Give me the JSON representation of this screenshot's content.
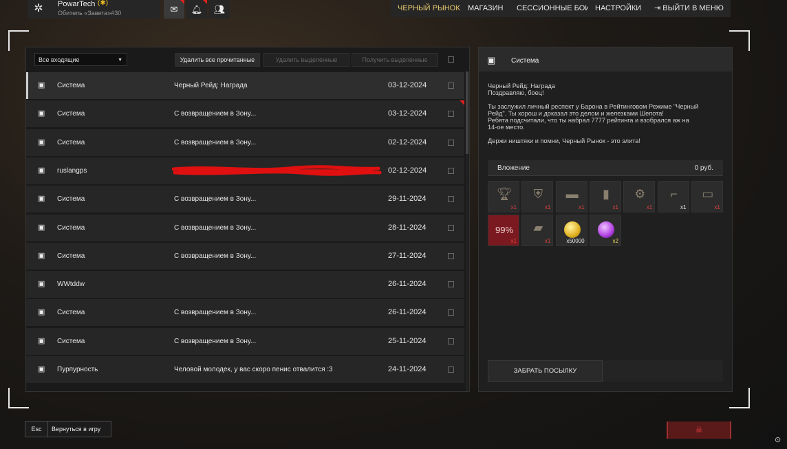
{
  "profile": {
    "username": "PowarTech",
    "rank_badge": "(✱)",
    "subtitle": "Обитель «Завета»#30"
  },
  "top_icons": [
    "mail-icon",
    "bell-icon",
    "friends-icon"
  ],
  "nav": {
    "black_market": "ЧЕРНЫЙ РЫНОК",
    "shop": "МАГАЗИН",
    "session_battles": "СЕССИОННЫЕ БОИ",
    "settings": "НАСТРОЙКИ",
    "exit_menu": "ВЫЙТИ В МЕНЮ",
    "active": "black_market"
  },
  "inbox": {
    "filter_selected": "Все входящие",
    "delete_read": "Удалить все прочитанные",
    "delete_selected": "Удалить выделенные",
    "get_selected": "Получить выделенные",
    "messages": [
      {
        "sender": "Система",
        "subject": "Черный Рейд: Награда",
        "date": "03-12-2024",
        "selected": true,
        "flag": false
      },
      {
        "sender": "Система",
        "subject": "С возвращением в Зону...",
        "date": "03-12-2024",
        "selected": false,
        "flag": true
      },
      {
        "sender": "Система",
        "subject": "С возвращением в Зону...",
        "date": "02-12-2024",
        "selected": false,
        "flag": false
      },
      {
        "sender": "ruslangps",
        "subject": "",
        "date": "02-12-2024",
        "selected": false,
        "flag": false,
        "redacted": true
      },
      {
        "sender": "Система",
        "subject": "С возвращением в Зону...",
        "date": "29-11-2024",
        "selected": false,
        "flag": false
      },
      {
        "sender": "Система",
        "subject": "С возвращением в Зону...",
        "date": "28-11-2024",
        "selected": false,
        "flag": false
      },
      {
        "sender": "Система",
        "subject": "С возвращением в Зону...",
        "date": "27-11-2024",
        "selected": false,
        "flag": false
      },
      {
        "sender": "WWtddw",
        "subject": "",
        "date": "26-11-2024",
        "selected": false,
        "flag": false
      },
      {
        "sender": "Система",
        "subject": "С возвращением в Зону...",
        "date": "26-11-2024",
        "selected": false,
        "flag": false
      },
      {
        "sender": "Система",
        "subject": "С возвращением в Зону...",
        "date": "25-11-2024",
        "selected": false,
        "flag": false
      },
      {
        "sender": "Пурпурность",
        "subject": "Человой молодек, у вас скоро пенис отвалится :3",
        "date": "24-11-2024",
        "selected": false,
        "flag": false
      }
    ]
  },
  "detail": {
    "sender": "Система",
    "lines": [
      "Черный Рейд: Награда",
      "Поздравляю, боец!",
      "",
      "Ты заслужил личный респект у Барона в Рейтинговом Режиме \"Черный",
      "Рейд\". Ты хорош и доказал это делом и железками Шепота!",
      "Ребята подсчитали, что ты набрал 7777 рейтинга и взобрался аж на",
      "14-ое место.",
      "",
      "Держи ништяки и помни, Черный Рынок - это элита!"
    ],
    "attachment_label": "Вложение",
    "attachment_value": "0 руб.",
    "items_row1": [
      {
        "icon": "trophy-icon",
        "qty": "x1"
      },
      {
        "icon": "armor-icon",
        "qty": "x1"
      },
      {
        "icon": "barrel-icon",
        "qty": "x1"
      },
      {
        "icon": "magazine-icon",
        "qty": "x1"
      },
      {
        "icon": "weapon-part-icon",
        "qty": "x1"
      },
      {
        "icon": "weapon-icon",
        "qty": "x1"
      },
      {
        "icon": "receiver-icon",
        "qty": "x1"
      }
    ],
    "items_row2": [
      {
        "icon": "percent-icon",
        "label": "99%",
        "qty": "x1"
      },
      {
        "icon": "device-icon",
        "qty": "x1"
      },
      {
        "icon": "gold-coin-icon",
        "qty": "x50000"
      },
      {
        "icon": "purple-coin-icon",
        "qty": "x2"
      }
    ],
    "claim_button": "ЗАБРАТЬ ПОСЫЛКУ"
  },
  "bottom": {
    "esc_key": "Esc",
    "return_label": "Вернуться в игру",
    "exit_icon": "skull-icon"
  },
  "colors": {
    "accent": "#e8c870",
    "flag": "#e02020",
    "exit": "#5a1a1a"
  }
}
